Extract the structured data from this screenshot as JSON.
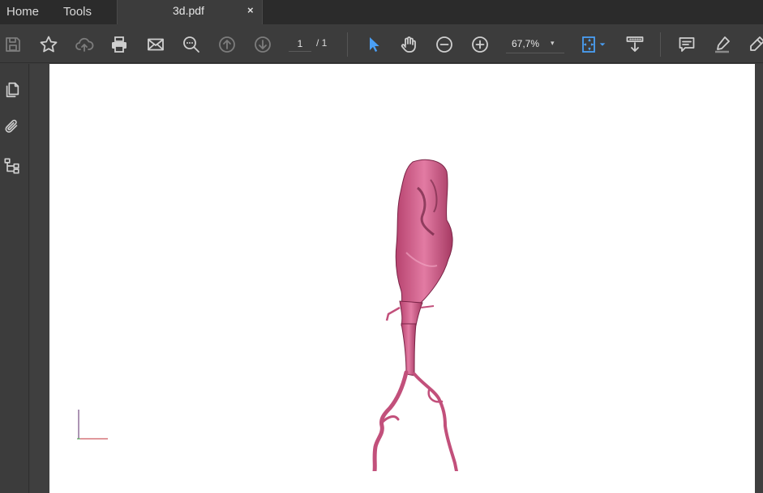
{
  "tabs": {
    "home": "Home",
    "tools": "Tools",
    "document": "3d.pdf",
    "close_glyph": "×"
  },
  "toolbar": {
    "page_current": "1",
    "page_total": "/ 1",
    "zoom": "67,7%",
    "zoom_caret": "▾",
    "icons": [
      "save-icon",
      "bookmark-star-icon",
      "cloud-upload-icon",
      "print-icon",
      "email-icon",
      "zoom-search-icon",
      "page-up-icon",
      "page-down-icon",
      "select-cursor-icon",
      "hand-pan-icon",
      "zoom-out-icon",
      "zoom-in-icon",
      "fit-page-icon",
      "scroll-mode-icon",
      "comment-icon",
      "highlight-pen-icon",
      "sign-icon"
    ],
    "active_tool": "select-cursor-icon"
  },
  "left_panel": {
    "icons": [
      "page-thumbnails-icon",
      "attachments-icon",
      "layers-icon"
    ],
    "collapse_glyph": "◀"
  },
  "document": {
    "model_description_color": "#d9678f",
    "background": "#ffffff"
  },
  "colors": {
    "accent_blue": "#4a9ff5",
    "toolbar_bg": "#3c3c3c",
    "tabbar_bg": "#2b2b2b"
  }
}
